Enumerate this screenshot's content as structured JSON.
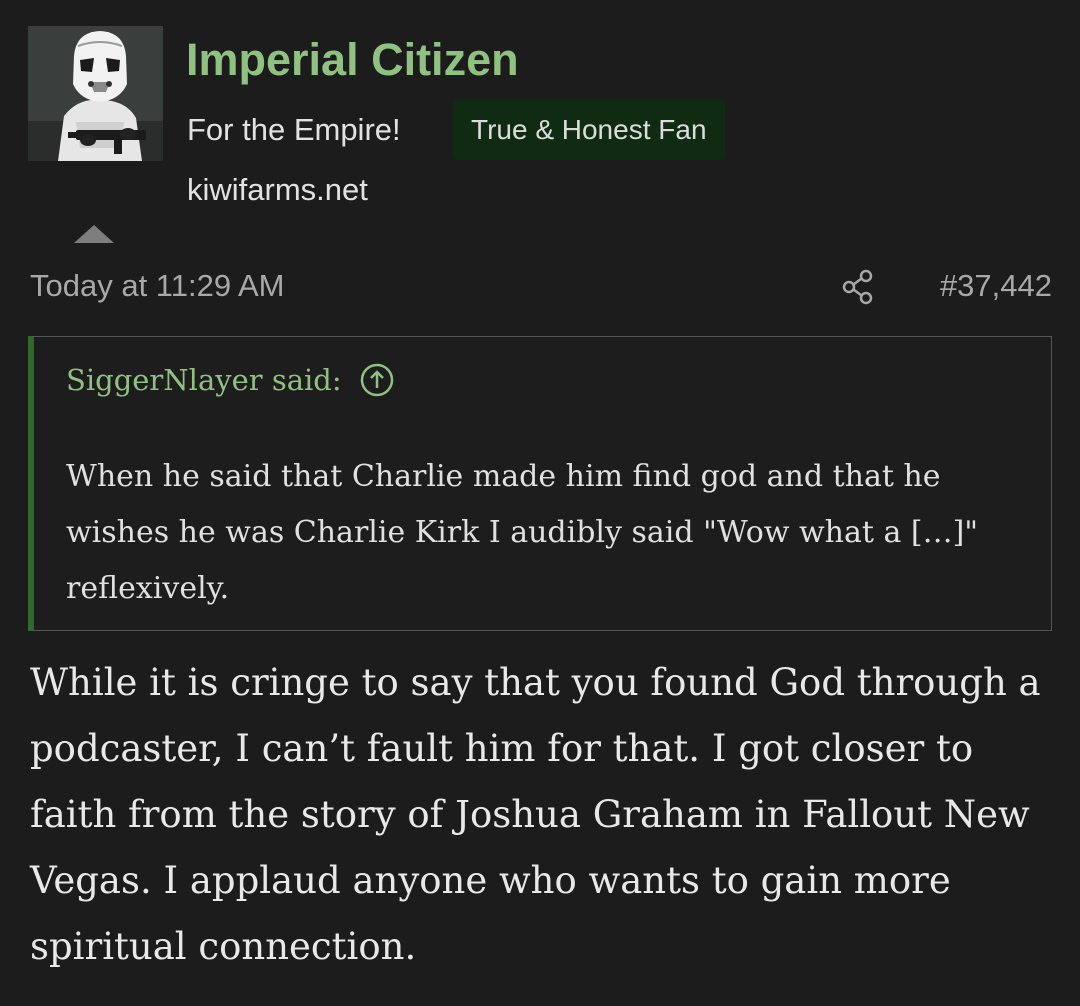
{
  "post": {
    "author": {
      "username": "Imperial Citizen",
      "user_title": "For the Empire!",
      "banner": "True & Honest Fan",
      "website": "kiwifarms.net",
      "avatar_icon": "stormtrooper-avatar"
    },
    "meta": {
      "timestamp": "Today at 11:29 AM",
      "post_number": "#37,442",
      "share_icon": "share-icon"
    },
    "quote": {
      "attribution": "SiggerNlayer said:",
      "jump_icon": "arrow-up-circle-icon",
      "text": "When he said that Charlie made him find god and that he wishes he was Charlie Kirk I audibly said \"Wow what a […]\" reflexively."
    },
    "body": "While it is cringe to say that you found God through a podcaster, I can’t fault him for that. I got closer to faith from the story of Joshua Graham in Fallout New Vegas. I applaud anyone who wants to gain more spiritual connection."
  },
  "colors": {
    "background": "#1c1c1c",
    "username": "#8fc181",
    "banner_bg": "#0f2c12",
    "quote_bar": "#2e6b2a",
    "muted_text": "#a8a8a8"
  }
}
